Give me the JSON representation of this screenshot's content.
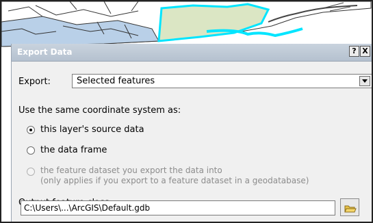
{
  "dialog": {
    "title": "Export Data",
    "help_button": "?",
    "close_button": "X",
    "export_label": "Export:",
    "export_value": "Selected features",
    "coordinate_prompt": "Use the same coordinate system as:",
    "options": [
      {
        "label": "this layer's source data",
        "checked": true,
        "enabled": true
      },
      {
        "label": "the data frame",
        "checked": false,
        "enabled": true
      },
      {
        "label": "the feature dataset you export the data into",
        "note": "(only applies if you export to a feature dataset in a geodatabase)",
        "checked": false,
        "enabled": false
      }
    ],
    "output_label": "Output feature class:",
    "output_path_visible": "C:\\Users\\...\\ArcGIS\\Default.gdb"
  },
  "colors": {
    "titlebar": "#b5c1cf",
    "dialog_bg": "#f0f0f0",
    "map_boundary_highlight": "#00e5ff",
    "map_land_fill": "#dbe6c4",
    "map_water_fill": "#b9d0e8"
  }
}
